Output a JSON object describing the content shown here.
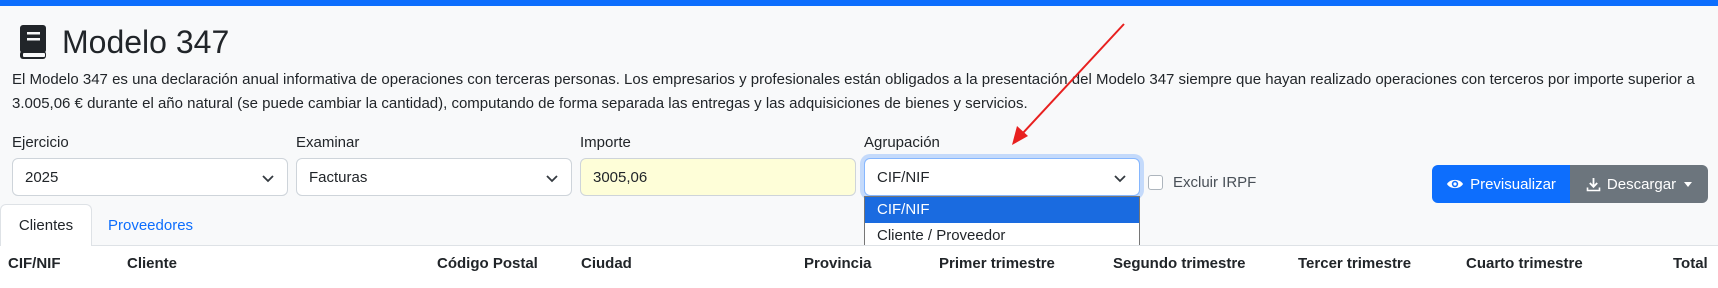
{
  "page": {
    "title": "Modelo 347",
    "title_icon": "book-icon",
    "description": "El Modelo 347 es una declaración anual informativa de operaciones con terceras personas. Los empresarios y profesionales están obligados a la presentación del Modelo 347 siempre que hayan realizado operaciones con terceros por importe superior a 3.005,06 € durante el año natural (se puede cambiar la cantidad), computando de forma separada las entregas y las adquisiciones de bienes y servicios."
  },
  "filters": {
    "ejercicio": {
      "label": "Ejercicio",
      "value": "2025"
    },
    "examinar": {
      "label": "Examinar",
      "value": "Facturas"
    },
    "importe": {
      "label": "Importe",
      "value": "3005,06"
    },
    "agrupacion": {
      "label": "Agrupación",
      "value": "CIF/NIF",
      "options": [
        "CIF/NIF",
        "Cliente / Proveedor"
      ]
    },
    "excluir_irpf": {
      "label": "Excluir IRPF",
      "checked": false
    }
  },
  "actions": {
    "preview_label": "Previsualizar",
    "download_label": "Descargar"
  },
  "tabs": [
    {
      "label": "Clientes",
      "active": true
    },
    {
      "label": "Proveedores",
      "active": false
    }
  ],
  "table": {
    "columns": [
      "CIF/NIF",
      "Cliente",
      "Código Postal",
      "Ciudad",
      "Provincia",
      "Primer trimestre",
      "Segundo trimestre",
      "Tercer trimestre",
      "Cuarto trimestre",
      "Total"
    ]
  },
  "colors": {
    "accent": "#0d6efd",
    "secondary": "#6c757d",
    "importe_bg": "#fefed8",
    "annotation_arrow": "#e8201f",
    "selected_option": "#1a6be0"
  }
}
